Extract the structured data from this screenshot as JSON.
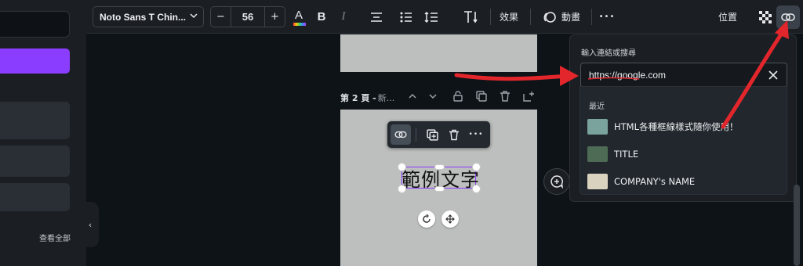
{
  "left_panel": {
    "see_all_label": "查看全部",
    "collapse_glyph": "‹"
  },
  "toolbar": {
    "font_name": "Noto Sans T Chin...",
    "font_size": "56",
    "minus_glyph": "−",
    "plus_glyph": "+",
    "bold_glyph": "B",
    "italic_glyph": "I",
    "effects_label": "效果",
    "animate_label": "動畫",
    "more_glyph": "•••",
    "position_label": "位置",
    "text_color_glyph": "A"
  },
  "canvas": {
    "page_title": "第 2 頁 - ",
    "page_subtitle": "新...",
    "sample_text": "範例文字"
  },
  "link_popup": {
    "label": "輸入連結或搜尋",
    "input_value": "https://google.com",
    "recent_label": "最近",
    "recent_items": [
      {
        "title": "HTML各種框線樣式隨你使用！",
        "thumb_color": "#7aa39e"
      },
      {
        "title": "TITLE",
        "thumb_color": "#4d6b55"
      },
      {
        "title": "COMPANY's NAME",
        "thumb_color": "#d8d2bf"
      }
    ]
  },
  "colors": {
    "accent_purple": "#8b3dff",
    "annotation_red": "#e3262b",
    "page_gray": "#bdbfbe"
  }
}
